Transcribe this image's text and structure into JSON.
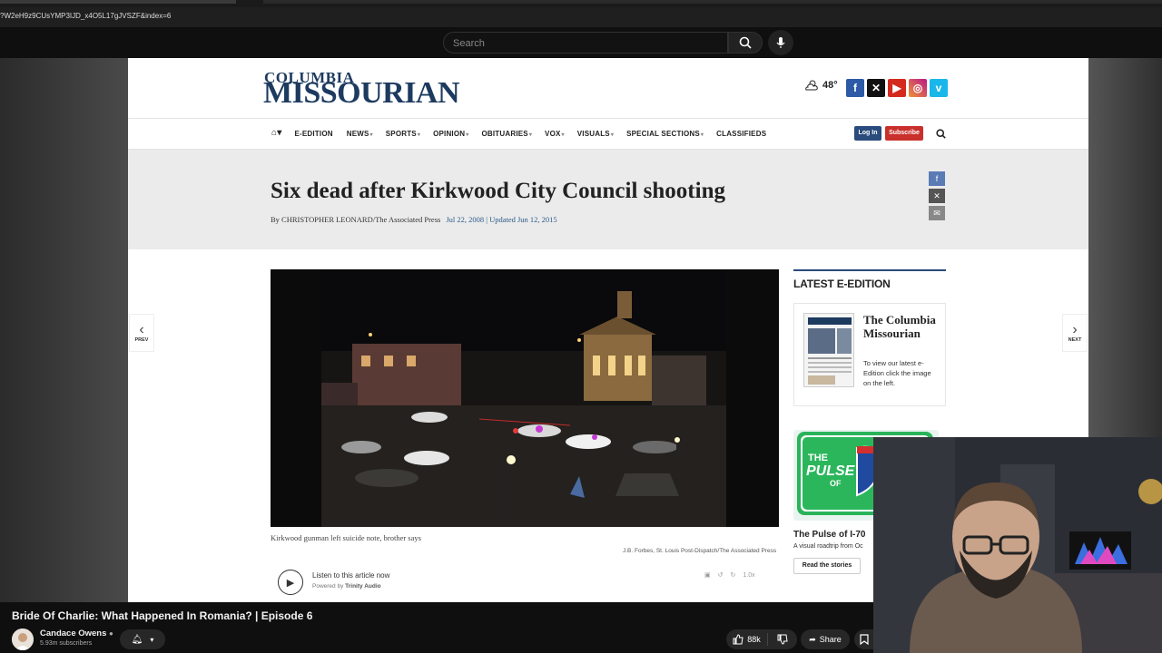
{
  "browser": {
    "url": "?W2eH9z9CUsYMP3IJD_x4O5L17gJVSZF&index=6"
  },
  "youtube": {
    "search_placeholder": "Search",
    "video_title": "Bride Of Charlie: What Happened In Romania? | Episode 6",
    "channel_name": "Candace Owens",
    "subscribers": "5.93m subscribers",
    "likes": "88k",
    "share_label": "Share"
  },
  "site": {
    "logo_top": "COLUMBIA",
    "logo_main": "MISSOURIAN",
    "temperature": "48°",
    "nav": [
      "E-EDITION",
      "NEWS",
      "SPORTS",
      "OPINION",
      "OBITUARIES",
      "VOX",
      "VISUALS",
      "SPECIAL SECTIONS",
      "CLASSIFIEDS"
    ],
    "login": "Log In",
    "subscribe": "Subscribe",
    "prev": "PREV",
    "next": "NEXT"
  },
  "article": {
    "headline": "Six dead after Kirkwood City Council shooting",
    "byline": "By CHRISTOPHER LEONARD/The Associated Press",
    "dates": "Jul 22, 2008 | Updated Jun 12, 2015",
    "caption": "Kirkwood gunman left suicide note, brother says",
    "credit": "J.B. Forbes, St. Louis Post-Dispatch/The Associated Press",
    "listen": "Listen to this article now",
    "powered_prefix": "Powered by",
    "powered_by": "Trinity Audio",
    "speed": "1.0x"
  },
  "sidebar": {
    "heading": "LATEST E-EDITION",
    "ee_title": "The Columbia Missourian",
    "ee_desc": "To view our latest e-Edition click the image on the left.",
    "pulse_title": "The Pulse of I-70",
    "pulse_sub": "A visual roadtrip from Oc",
    "read_stories": "Read the stories",
    "pulse_badge_line1": "THE",
    "pulse_badge_line2": "PULSE",
    "pulse_badge_line3": "OF"
  }
}
